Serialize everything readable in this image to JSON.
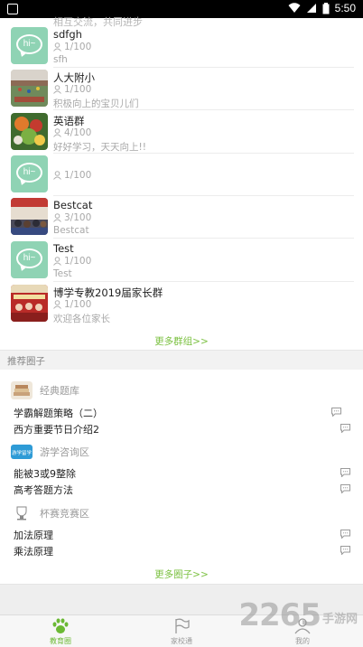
{
  "status_bar": {
    "time": "5:50"
  },
  "partial_top_text": "相互交流，共同进步",
  "groups": [
    {
      "name": "sdfgh",
      "count": "1/100",
      "desc": "sfh",
      "avatar": "hi-avatar"
    },
    {
      "name": "人大附小",
      "count": "1/100",
      "desc": "积极向上的宝贝儿们",
      "avatar": "photo-playground"
    },
    {
      "name": "英语群",
      "count": "4/100",
      "desc": "好好学习，天天向上!!",
      "avatar": "photo-fruit"
    },
    {
      "name": "",
      "count": "1/100",
      "desc": "",
      "avatar": "hi-avatar"
    },
    {
      "name": "Bestcat",
      "count": "3/100",
      "desc": "Bestcat",
      "avatar": "photo-classroom"
    },
    {
      "name": "Test",
      "count": "1/100",
      "desc": "Test",
      "avatar": "hi-avatar"
    },
    {
      "name": "博学专教2019届家长群",
      "count": "1/100",
      "desc": "欢迎各位家长",
      "avatar": "photo-banner"
    }
  ],
  "more_groups": "更多群组>>",
  "section_title": "推荐圈子",
  "categories": [
    {
      "label": "经典题库",
      "topics": [
        "学霸解题策略（二）",
        "西方重要节日介绍2"
      ]
    },
    {
      "label": "游学咨询区",
      "icon_text": "游学留学",
      "topics": [
        "能被3或9整除",
        "高考答题方法"
      ]
    },
    {
      "label": "杯赛竞赛区",
      "topics": [
        "加法原理",
        "乘法原理"
      ]
    }
  ],
  "more_circles": "更多圈子>>",
  "tabs": [
    {
      "label": "教育圈",
      "active": true
    },
    {
      "label": "家校通",
      "active": false
    },
    {
      "label": "我的",
      "active": false
    }
  ],
  "watermark": {
    "number": "2265",
    "text": "手游网"
  },
  "colors": {
    "accent_green": "#7cc142",
    "avatar_mint": "#8fd3b4",
    "status_bar": "#000000"
  }
}
